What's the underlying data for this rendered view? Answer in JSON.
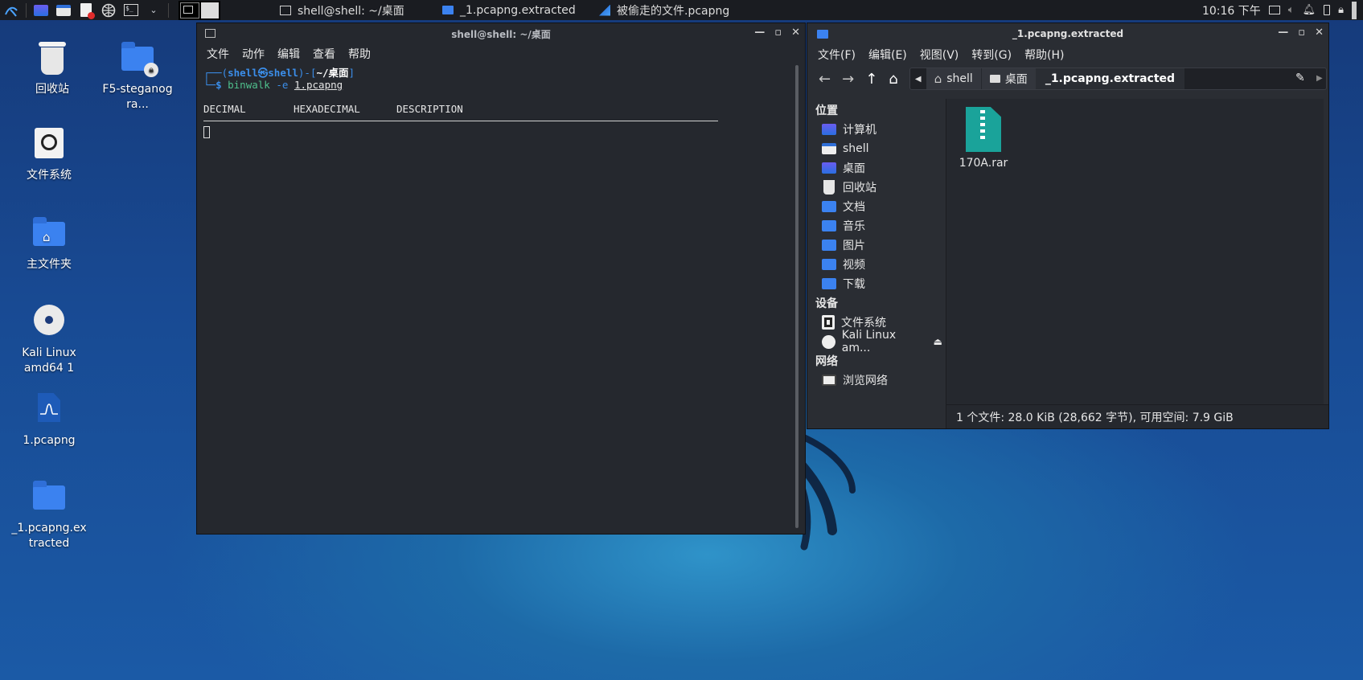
{
  "taskbar": {
    "tasks": [
      {
        "label": "shell@shell: ~/桌面"
      },
      {
        "label": "_1.pcapng.extracted"
      },
      {
        "label": "被偷走的文件.pcapng"
      }
    ],
    "clock": "10:16 下午"
  },
  "desktop": {
    "icons": [
      {
        "label": "回收站"
      },
      {
        "label": "F5-steganogra..."
      },
      {
        "label": "文件系统"
      },
      {
        "label": "主文件夹"
      },
      {
        "label": "Kali Linux amd64 1"
      },
      {
        "label": "1.pcapng"
      },
      {
        "label": "_1.pcapng.extracted"
      }
    ]
  },
  "terminal": {
    "title": "shell@shell: ~/桌面",
    "menu": [
      "文件",
      "动作",
      "编辑",
      "查看",
      "帮助"
    ],
    "prompt_user": "shell",
    "prompt_at": "㉿",
    "prompt_host": "shell",
    "prompt_path": "~/桌面",
    "command": "binwalk",
    "option": "-e",
    "argument": "1.pcapng",
    "headers": [
      "DECIMAL",
      "HEXADECIMAL",
      "DESCRIPTION"
    ]
  },
  "filemanager": {
    "title": "_1.pcapng.extracted",
    "menu": [
      "文件(F)",
      "编辑(E)",
      "视图(V)",
      "转到(G)",
      "帮助(H)"
    ],
    "breadcrumbs": [
      "shell",
      "桌面",
      "_1.pcapng.extracted"
    ],
    "sidebar": {
      "places_heading": "位置",
      "places": [
        "计算机",
        "shell",
        "桌面",
        "回收站",
        "文档",
        "音乐",
        "图片",
        "视频",
        "下载"
      ],
      "devices_heading": "设备",
      "devices": [
        "文件系统",
        "Kali Linux am..."
      ],
      "network_heading": "网络",
      "network": [
        "浏览网络"
      ]
    },
    "files": [
      {
        "name": "170A.rar"
      }
    ],
    "status": "1 个文件: 28.0 KiB (28,662 字节), 可用空间: 7.9 GiB"
  },
  "colors": {
    "folder_blue": "#3b82f0",
    "terminal_bg": "#25282e",
    "prompt_blue": "#3b8eea",
    "archive_teal": "#1aa39a"
  }
}
